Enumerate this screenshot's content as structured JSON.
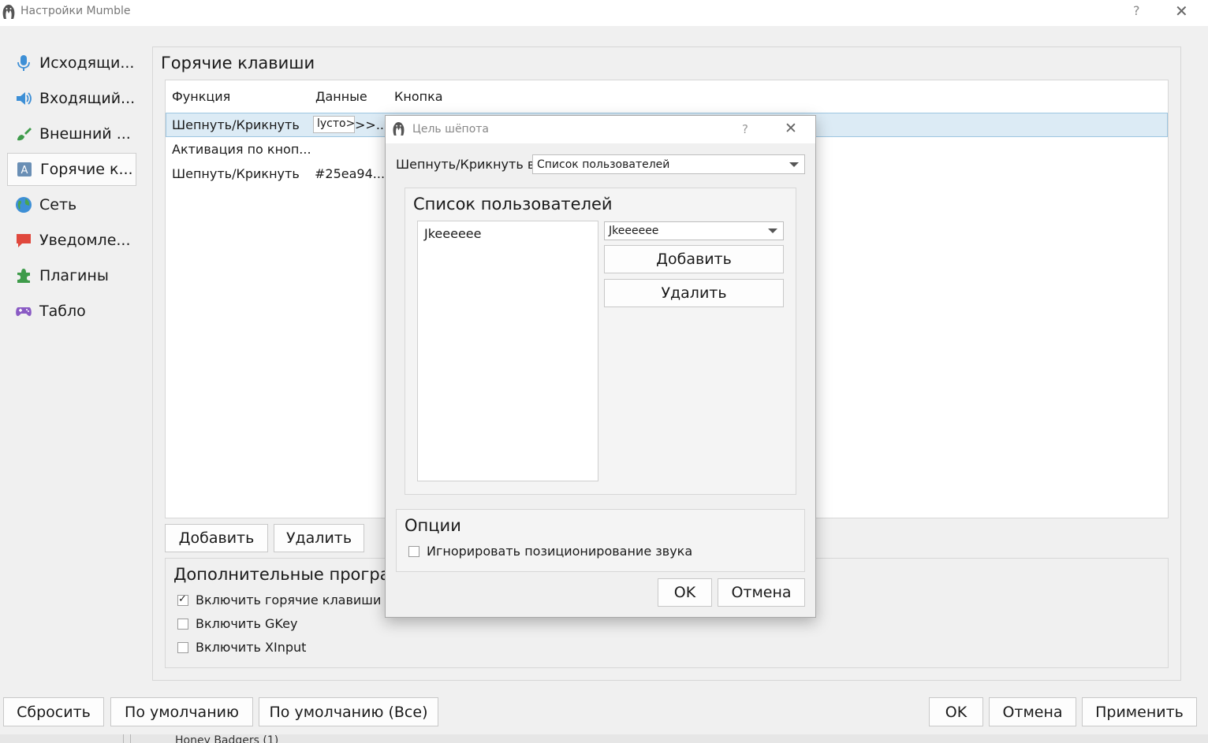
{
  "window": {
    "title": "Настройки Mumble",
    "help": "?",
    "close": "✕"
  },
  "sidebar": {
    "items": [
      {
        "label": "Исходящи...",
        "icon": "microphone-icon"
      },
      {
        "label": "Входящий...",
        "icon": "speaker-icon"
      },
      {
        "label": "Внешний ...",
        "icon": "brush-icon"
      },
      {
        "label": "Горячие к...",
        "icon": "keyboard-key-icon"
      },
      {
        "label": "Сеть",
        "icon": "globe-icon"
      },
      {
        "label": "Уведомле...",
        "icon": "message-icon"
      },
      {
        "label": "Плагины",
        "icon": "puzzle-icon"
      },
      {
        "label": "Табло",
        "icon": "gamepad-icon"
      }
    ],
    "active_index": 3
  },
  "main": {
    "title": "Горячие клавиши",
    "table": {
      "columns": [
        "Функция",
        "Данные",
        "Кнопка"
      ],
      "rows": [
        {
          "function": "Шепнуть/Крикнуть",
          "data_edit": "lycто>",
          "data": ">>..."
        },
        {
          "function": "Активация по кноп...",
          "data": ""
        },
        {
          "function": "Шепнуть/Крикнуть",
          "data": "#25ea94..."
        }
      ]
    },
    "add_button": "Добавить",
    "remove_button": "Удалить",
    "extra_group": {
      "title": "Дополнительные програм",
      "options": [
        {
          "label": "Включить горячие клавиши в",
          "checked": true
        },
        {
          "label": "Включить GKey",
          "checked": false
        },
        {
          "label": "Включить XInput",
          "checked": false
        }
      ]
    }
  },
  "footer": {
    "reset": "Сбросить",
    "defaults": "По умолчанию",
    "defaults_all": "По умолчанию (Все)",
    "ok": "OK",
    "cancel": "Отмена",
    "apply": "Применить",
    "behind_text": "Honey Badgers (1)"
  },
  "dialog": {
    "title": "Цель шёпота",
    "help": "?",
    "close": "✕",
    "target_label": "Шепнуть/Крикнуть в:",
    "target_value": "Список пользователей",
    "user_group": {
      "title": "Список пользователей",
      "list_items": [
        "Jkeeeeee"
      ],
      "user_combo": "Jkeeeeee",
      "add": "Добавить",
      "remove": "Удалить"
    },
    "options": {
      "title": "Опции",
      "ignore_positional": {
        "label": "Игнорировать позиционирование звука",
        "checked": false
      }
    },
    "ok": "OK",
    "cancel": "Отмена"
  }
}
